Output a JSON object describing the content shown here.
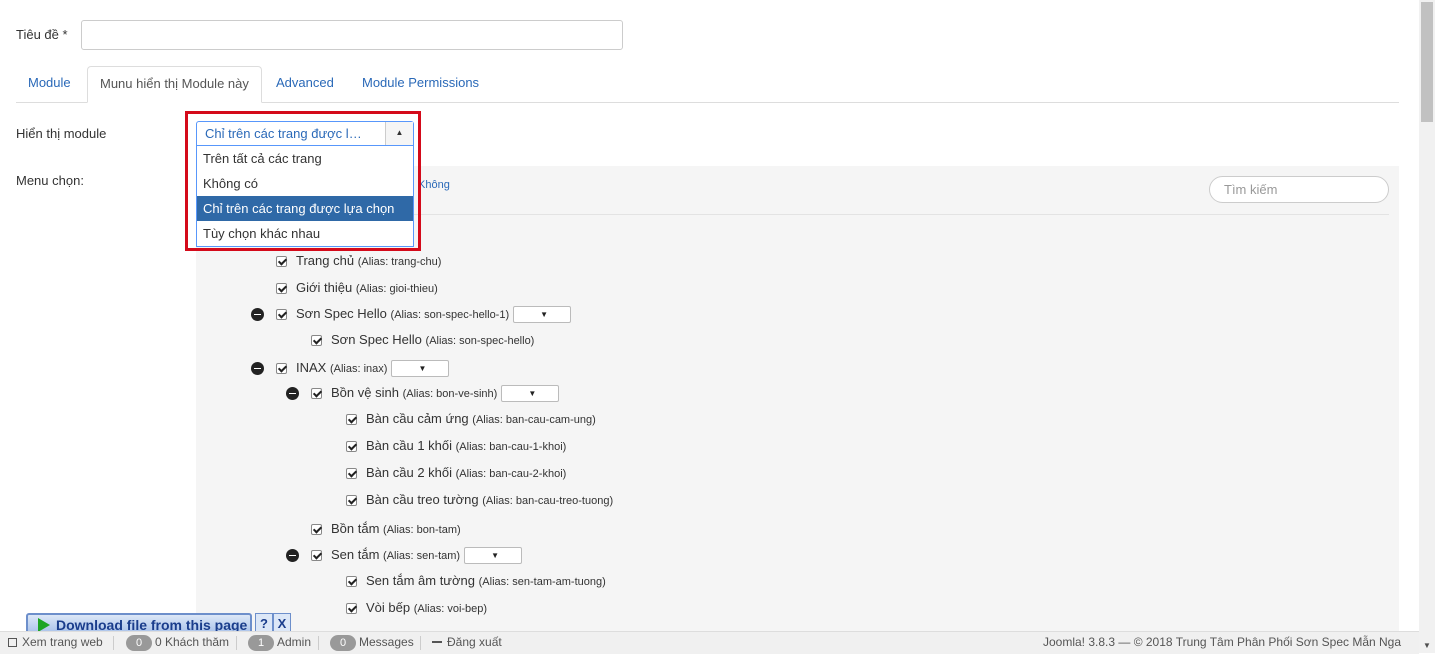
{
  "form": {
    "title_label": "Tiêu đề *",
    "title_value": ""
  },
  "tabs": [
    {
      "label": "Module",
      "active": false
    },
    {
      "label": "Munu hiển thị Module này",
      "active": true
    },
    {
      "label": "Advanced",
      "active": false
    },
    {
      "label": "Module Permissions",
      "active": false
    }
  ],
  "assignment": {
    "label": "Hiển thị module",
    "selected": "Chỉ trên các trang được lựa chọn",
    "options": [
      "Trên tất cả các trang",
      "Không có",
      "Chỉ trên các trang được lựa chọn",
      "Tùy chọn khác nhau"
    ]
  },
  "menu": {
    "label": "Menu chọn:",
    "top_link": "Không",
    "search_placeholder": "Tìm kiếm",
    "items": [
      {
        "title": "Trang chủ",
        "alias": "(Alias: trang-chu)",
        "level": 0,
        "has_children": false
      },
      {
        "title": "Giới thiệu",
        "alias": "(Alias: gioi-thieu)",
        "level": 0,
        "has_children": false
      },
      {
        "title": "Sơn Spec Hello",
        "alias": "(Alias: son-spec-hello-1)",
        "level": 0,
        "has_children": true
      },
      {
        "title": "Sơn Spec Hello",
        "alias": "(Alias: son-spec-hello)",
        "level": 1,
        "has_children": false
      },
      {
        "title": "INAX",
        "alias": "(Alias: inax)",
        "level": 0,
        "has_children": true
      },
      {
        "title": "Bồn vệ sinh",
        "alias": "(Alias: bon-ve-sinh)",
        "level": 1,
        "has_children": true
      },
      {
        "title": "Bàn cầu cảm ứng",
        "alias": "(Alias: ban-cau-cam-ung)",
        "level": 2,
        "has_children": false
      },
      {
        "title": "Bàn cầu 1 khối",
        "alias": "(Alias: ban-cau-1-khoi)",
        "level": 2,
        "has_children": false
      },
      {
        "title": "Bàn cầu 2 khối",
        "alias": "(Alias: ban-cau-2-khoi)",
        "level": 2,
        "has_children": false
      },
      {
        "title": "Bàn cầu treo tường",
        "alias": "(Alias: ban-cau-treo-tuong)",
        "level": 2,
        "has_children": false
      },
      {
        "title": "Bồn tắm",
        "alias": "(Alias: bon-tam)",
        "level": 1,
        "has_children": false
      },
      {
        "title": "Sen tắm",
        "alias": "(Alias: sen-tam)",
        "level": 1,
        "has_children": true
      },
      {
        "title": "Sen tắm âm tường",
        "alias": "(Alias: sen-tam-am-tuong)",
        "level": 2,
        "has_children": false
      },
      {
        "title": "Vòi bếp",
        "alias": "(Alias: voi-bep)",
        "level": 2,
        "has_children": false
      }
    ]
  },
  "download_bar": {
    "label": "Download file from this page",
    "help": "?",
    "close": "X"
  },
  "footer": {
    "view_site": "Xem trang web",
    "visitors_count": "0",
    "visitors_label": "0 Khách thăm",
    "admins_count": "1",
    "admins_label": "Admin",
    "messages_count": "0",
    "messages_label": "Messages",
    "logout": "Đăng xuất",
    "copyright": "Joomla! 3.8.3 — © 2018 Trung Tâm Phân Phối Sơn Spec Mẫn Nga"
  }
}
